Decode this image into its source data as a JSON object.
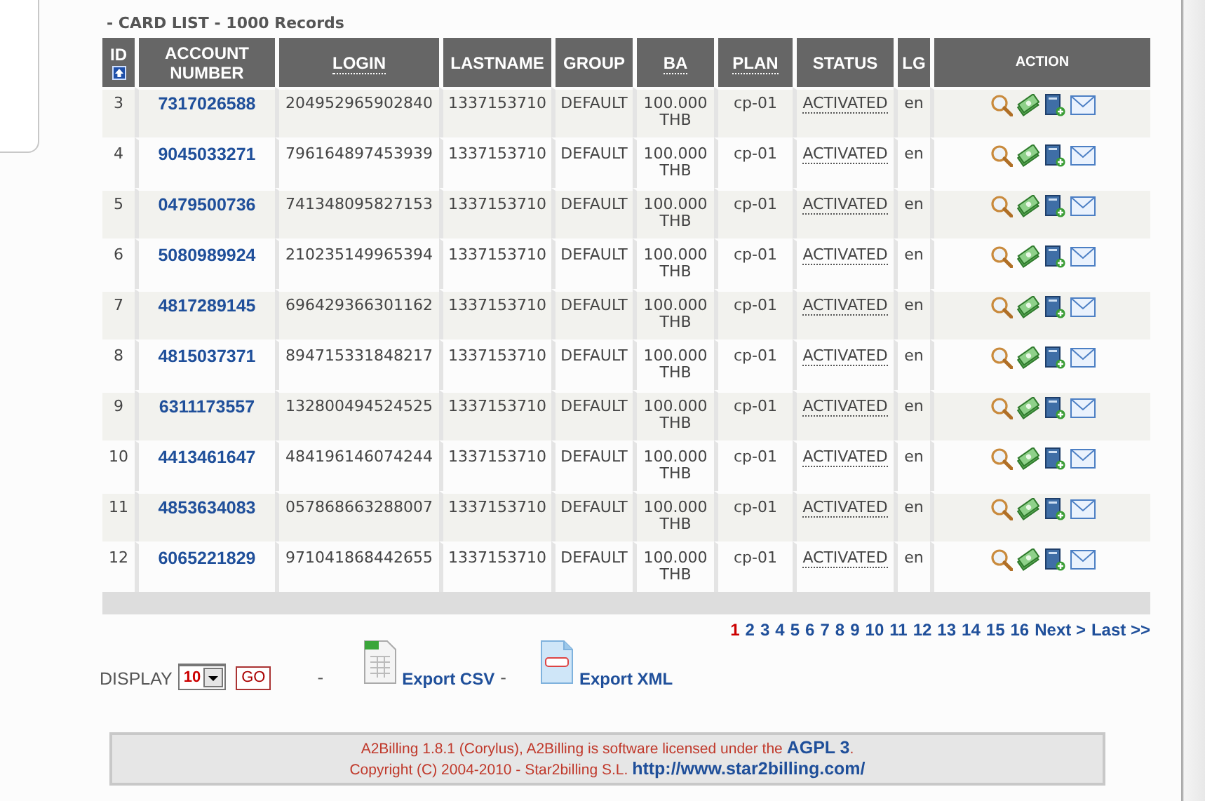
{
  "title": "- CARD LIST - 1000 Records",
  "table": {
    "columns": [
      {
        "label": "ID",
        "sort_icon": true,
        "underlined": false
      },
      {
        "label": "ACCOUNT NUMBER",
        "sort_icon": false,
        "underlined": false
      },
      {
        "label": "LOGIN",
        "sort_icon": false,
        "underlined": true
      },
      {
        "label": "LASTNAME",
        "sort_icon": false,
        "underlined": false
      },
      {
        "label": "GROUP",
        "sort_icon": false,
        "underlined": false
      },
      {
        "label": "BA",
        "sort_icon": false,
        "underlined": true
      },
      {
        "label": "PLAN",
        "sort_icon": false,
        "underlined": true
      },
      {
        "label": "STATUS",
        "sort_icon": false,
        "underlined": false
      },
      {
        "label": "LG",
        "sort_icon": false,
        "underlined": false
      },
      {
        "label": "ACTION",
        "sort_icon": false,
        "underlined": false
      }
    ],
    "rows": [
      {
        "id": "3",
        "account": "7317026588",
        "login": "204952965902840",
        "lastname": "1337153710",
        "group": "DEFAULT",
        "balance": "100.000",
        "currency": "THB",
        "plan": "cp-01",
        "status": "ACTIVATED",
        "lang": "en"
      },
      {
        "id": "4",
        "account": "9045033271",
        "login": "796164897453939",
        "lastname": "1337153710",
        "group": "DEFAULT",
        "balance": "100.000",
        "currency": "THB",
        "plan": "cp-01",
        "status": "ACTIVATED",
        "lang": "en"
      },
      {
        "id": "5",
        "account": "0479500736",
        "login": "741348095827153",
        "lastname": "1337153710",
        "group": "DEFAULT",
        "balance": "100.000",
        "currency": "THB",
        "plan": "cp-01",
        "status": "ACTIVATED",
        "lang": "en"
      },
      {
        "id": "6",
        "account": "5080989924",
        "login": "210235149965394",
        "lastname": "1337153710",
        "group": "DEFAULT",
        "balance": "100.000",
        "currency": "THB",
        "plan": "cp-01",
        "status": "ACTIVATED",
        "lang": "en"
      },
      {
        "id": "7",
        "account": "4817289145",
        "login": "696429366301162",
        "lastname": "1337153710",
        "group": "DEFAULT",
        "balance": "100.000",
        "currency": "THB",
        "plan": "cp-01",
        "status": "ACTIVATED",
        "lang": "en"
      },
      {
        "id": "8",
        "account": "4815037371",
        "login": "894715331848217",
        "lastname": "1337153710",
        "group": "DEFAULT",
        "balance": "100.000",
        "currency": "THB",
        "plan": "cp-01",
        "status": "ACTIVATED",
        "lang": "en"
      },
      {
        "id": "9",
        "account": "6311173557",
        "login": "132800494524525",
        "lastname": "1337153710",
        "group": "DEFAULT",
        "balance": "100.000",
        "currency": "THB",
        "plan": "cp-01",
        "status": "ACTIVATED",
        "lang": "en"
      },
      {
        "id": "10",
        "account": "4413461647",
        "login": "484196146074244",
        "lastname": "1337153710",
        "group": "DEFAULT",
        "balance": "100.000",
        "currency": "THB",
        "plan": "cp-01",
        "status": "ACTIVATED",
        "lang": "en"
      },
      {
        "id": "11",
        "account": "4853634083",
        "login": "057868663288007",
        "lastname": "1337153710",
        "group": "DEFAULT",
        "balance": "100.000",
        "currency": "THB",
        "plan": "cp-01",
        "status": "ACTIVATED",
        "lang": "en"
      },
      {
        "id": "12",
        "account": "6065221829",
        "login": "971041868442655",
        "lastname": "1337153710",
        "group": "DEFAULT",
        "balance": "100.000",
        "currency": "THB",
        "plan": "cp-01",
        "status": "ACTIVATED",
        "lang": "en"
      }
    ]
  },
  "pagination": [
    {
      "label": "1",
      "selected": true
    },
    {
      "label": "2",
      "selected": false
    },
    {
      "label": "3",
      "selected": false
    },
    {
      "label": "4",
      "selected": false
    },
    {
      "label": "5",
      "selected": false
    },
    {
      "label": "6",
      "selected": false
    },
    {
      "label": "7",
      "selected": false
    },
    {
      "label": "8",
      "selected": false
    },
    {
      "label": "9",
      "selected": false
    },
    {
      "label": "10",
      "selected": false
    },
    {
      "label": "11",
      "selected": false
    },
    {
      "label": "12",
      "selected": false
    },
    {
      "label": "13",
      "selected": false
    },
    {
      "label": "14",
      "selected": false
    },
    {
      "label": "15",
      "selected": false
    },
    {
      "label": "16",
      "selected": false
    },
    {
      "label": "Next >",
      "selected": false
    },
    {
      "label": "Last >>",
      "selected": false
    }
  ],
  "display": {
    "label": "DISPLAY",
    "value": "10",
    "go": "GO",
    "separator_1": "-",
    "export_csv": "Export CSV",
    "separator_2": "-",
    "export_xml": "Export XML"
  },
  "footer": {
    "line_1": "A2Billing 1.8.1 (Corylus), A2Billing is software licensed under the",
    "license_link": "AGPL 3",
    "line_1_end": ".",
    "line_2": "Copyright (C) 2004-2010 - Star2billing S.L.",
    "site_link": "http://www.star2billing.com/"
  }
}
